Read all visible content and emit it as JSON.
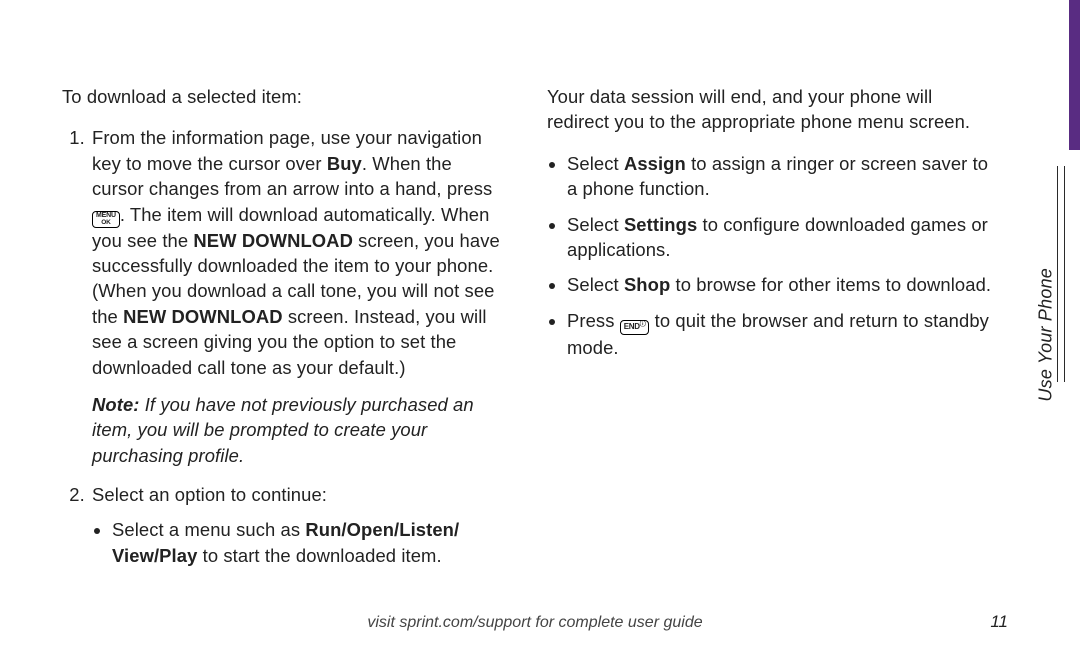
{
  "sideLabel": "Use Your Phone",
  "heading": "To download a selected item:",
  "step1": {
    "pre": "From the information page, use your navigation key to move the cursor over ",
    "buy": "Buy",
    "mid1": ". When the cursor changes from an arrow into a hand, press ",
    "keyTop": "MENU",
    "keyBottom": "OK",
    "mid2": ". The item will download automatically. When you see the ",
    "nd1": "NEW DOWNLOAD",
    "mid3": " screen, you have successfully downloaded the item to your phone. (When you download a call tone, you will not see the ",
    "nd2": "NEW DOWNLOAD",
    "post": " screen. Instead, you will see a screen giving you the option to set the downloaded call tone as your default.)"
  },
  "noteLabel": "Note:",
  "noteText": " If you have not previously purchased an item, you will be prompted to create your purchasing profile.",
  "step2": "Select an option to continue:",
  "b1": {
    "pre": "Select a menu such as ",
    "bold": "Run/Open/Listen/ View/Play",
    "post": " to start the downloaded item."
  },
  "col2Intro": "Your data session will end, and your phone will redirect you to the appropriate phone menu screen.",
  "b2": {
    "pre": "Select ",
    "bold": "Assign",
    "post": " to assign a ringer or screen saver to a phone function."
  },
  "b3": {
    "pre": "Select ",
    "bold": "Settings",
    "post": " to configure downloaded games or applications."
  },
  "b4": {
    "pre": "Select ",
    "bold": "Shop",
    "post": " to browse for other items to download."
  },
  "b5": {
    "pre": "Press ",
    "key": "END",
    "keySup": "ⓘ",
    "post": " to quit the browser and return to standby mode."
  },
  "footer": "visit sprint.com/support for complete user guide",
  "pageNum": "11"
}
